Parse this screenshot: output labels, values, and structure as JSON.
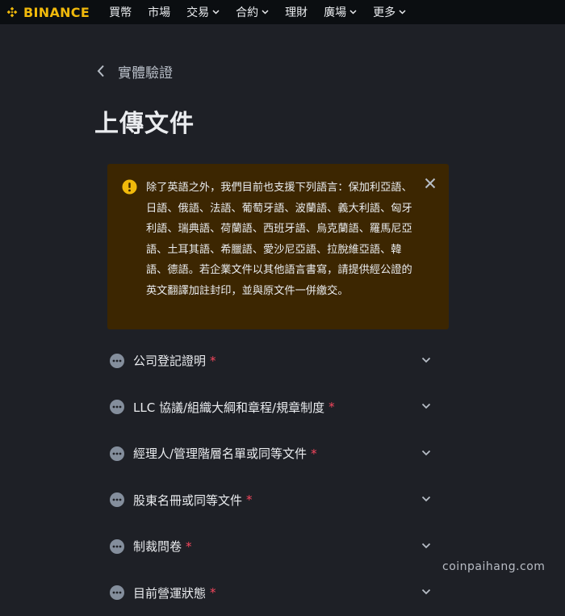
{
  "nav": {
    "brand": "BINANCE",
    "items": [
      {
        "label": "買幣",
        "dropdown": false
      },
      {
        "label": "市場",
        "dropdown": false
      },
      {
        "label": "交易",
        "dropdown": true
      },
      {
        "label": "合約",
        "dropdown": true
      },
      {
        "label": "理財",
        "dropdown": false
      },
      {
        "label": "廣場",
        "dropdown": true
      },
      {
        "label": "更多",
        "dropdown": true
      }
    ]
  },
  "back": {
    "label": "實體驗證"
  },
  "page": {
    "title": "上傳文件"
  },
  "notice": {
    "icon": "warning-icon",
    "text": "除了英語之外，我們目前也支援下列語言：保加利亞語、日語、俄語、法語、葡萄牙語、波蘭語、義大利語、匈牙利語、瑞典語、荷蘭語、西班牙語、烏克蘭語、羅馬尼亞語、土耳其語、希臘語、愛沙尼亞語、拉脫維亞語、韓語、德語。若企業文件以其他語言書寫，請提供經公證的英文翻譯加註封印，並與原文件一併繳交。"
  },
  "documents": [
    {
      "label": "公司登記證明",
      "required_mark": "*"
    },
    {
      "label": "LLC 協議/組織大綱和章程/規章制度",
      "required_mark": "*"
    },
    {
      "label": "經理人/管理階層名單或同等文件",
      "required_mark": "*"
    },
    {
      "label": "股東名冊或同等文件",
      "required_mark": "*"
    },
    {
      "label": "制裁問卷",
      "required_mark": "*"
    },
    {
      "label": "目前營運狀態",
      "required_mark": "*"
    }
  ],
  "watermark": "coinpaihang.com",
  "colors": {
    "background": "#1e2026",
    "nav_background": "#0b0e11",
    "brand_yellow": "#f0b90b",
    "notice_background": "#3c2601",
    "required_red": "#f6465d"
  }
}
